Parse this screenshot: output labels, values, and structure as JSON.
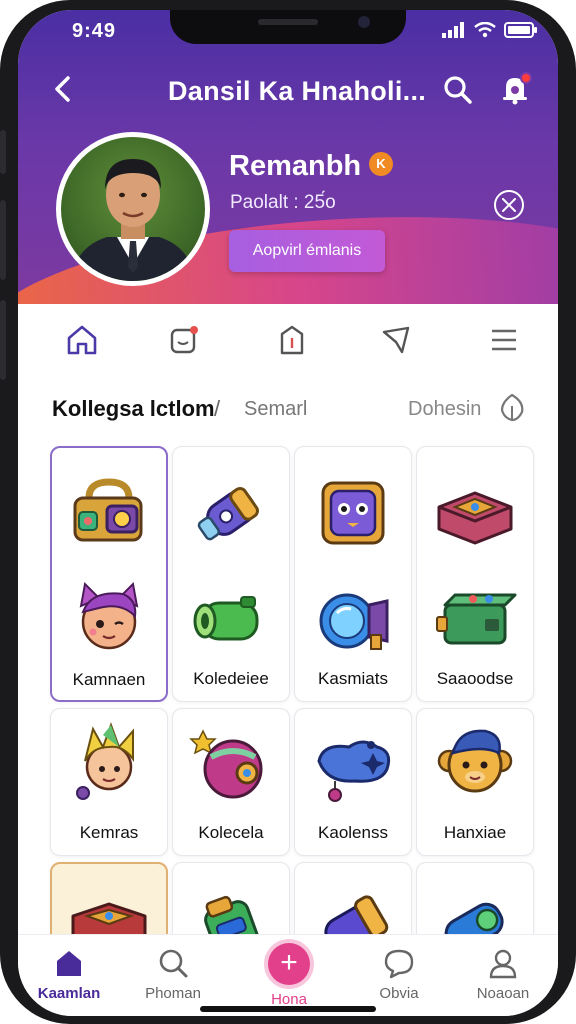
{
  "status_bar": {
    "time": "9:49"
  },
  "top_bar": {
    "title": "Dansil Ka Hnaholi..."
  },
  "profile": {
    "name": "Remanbh",
    "badge": "K",
    "subtitle": "Paolalt : 25́o",
    "cta_label": "Aopvirl émlanis"
  },
  "tabs": [
    {
      "icon": "home-outline-icon"
    },
    {
      "icon": "notification-icon"
    },
    {
      "icon": "bag-icon"
    },
    {
      "icon": "share-icon"
    },
    {
      "icon": "menu-icon"
    }
  ],
  "section": {
    "heading": "Kollegsa lctlom",
    "separator": "/",
    "secondary_tab": "Semarl",
    "link": "Dohesin"
  },
  "items": [
    {
      "label": "",
      "icon": "camera-bag-icon"
    },
    {
      "label": "",
      "icon": "rocket-capsule-icon"
    },
    {
      "label": "",
      "icon": "monster-box-icon"
    },
    {
      "label": "",
      "icon": "book-chest-icon"
    },
    {
      "label": "Kamnaen",
      "icon": "cat-creature-icon"
    },
    {
      "label": "Koledeiee",
      "icon": "green-capsule-icon"
    },
    {
      "label": "Kasmiats",
      "icon": "blue-orb-icon"
    },
    {
      "label": "Saaoodse",
      "icon": "gadget-box-icon"
    },
    {
      "label": "Kemras",
      "icon": "spiky-hero-icon"
    },
    {
      "label": "Kolecela",
      "icon": "round-pod-icon"
    },
    {
      "label": "Kaolenss",
      "icon": "blue-blob-icon"
    },
    {
      "label": "Hanxiae",
      "icon": "monkey-icon"
    },
    {
      "label": "",
      "icon": "treasure-book-icon"
    },
    {
      "label": "",
      "icon": "green-robot-icon"
    },
    {
      "label": "",
      "icon": "purple-cannon-icon"
    },
    {
      "label": "",
      "icon": "blue-cannon-icon"
    }
  ],
  "bottom_nav": [
    {
      "label": "Kaamlan",
      "icon": "home-icon"
    },
    {
      "label": "Phoman",
      "icon": "search-icon"
    },
    {
      "label": "Hona",
      "icon": "plus-icon"
    },
    {
      "label": "Obvia",
      "icon": "chat-icon"
    },
    {
      "label": "Noaoan",
      "icon": "profile-icon"
    }
  ],
  "colors": {
    "header_start": "#4a2fa3",
    "header_end": "#7d3aa0",
    "accent_orange": "#ec6a3e",
    "accent_pink": "#e2408a",
    "active_nav": "#4a2b9a"
  }
}
